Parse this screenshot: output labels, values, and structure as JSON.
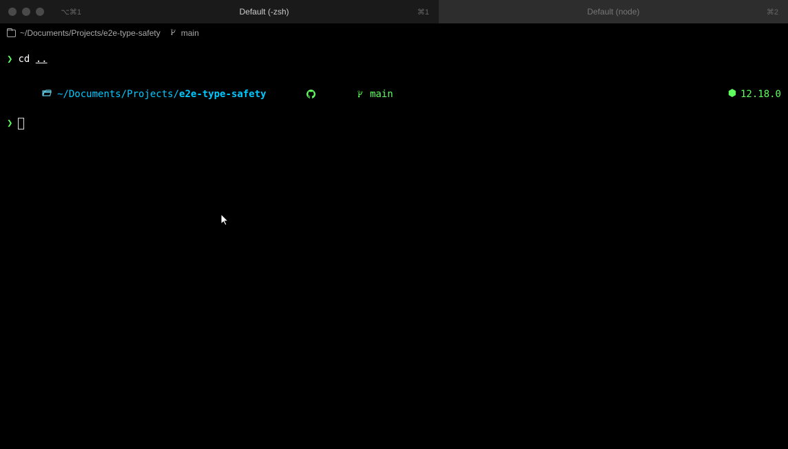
{
  "titlebar": {
    "newTabHint": "⌥⌘1"
  },
  "tabs": [
    {
      "label": "Default (-zsh)",
      "shortcut": "⌘1",
      "active": true
    },
    {
      "label": "Default (node)",
      "shortcut": "⌘2",
      "active": false
    }
  ],
  "pathbar": {
    "path": "~/Documents/Projects/e2e-type-safety",
    "branch": "main"
  },
  "history": {
    "cmd": "cd",
    "arg": ".."
  },
  "prompt": {
    "prefix": "~/Documents/Projects/",
    "dir": "e2e-type-safety",
    "branch": "main",
    "nodeVersion": "12.18.0",
    "chevron": "❯"
  }
}
